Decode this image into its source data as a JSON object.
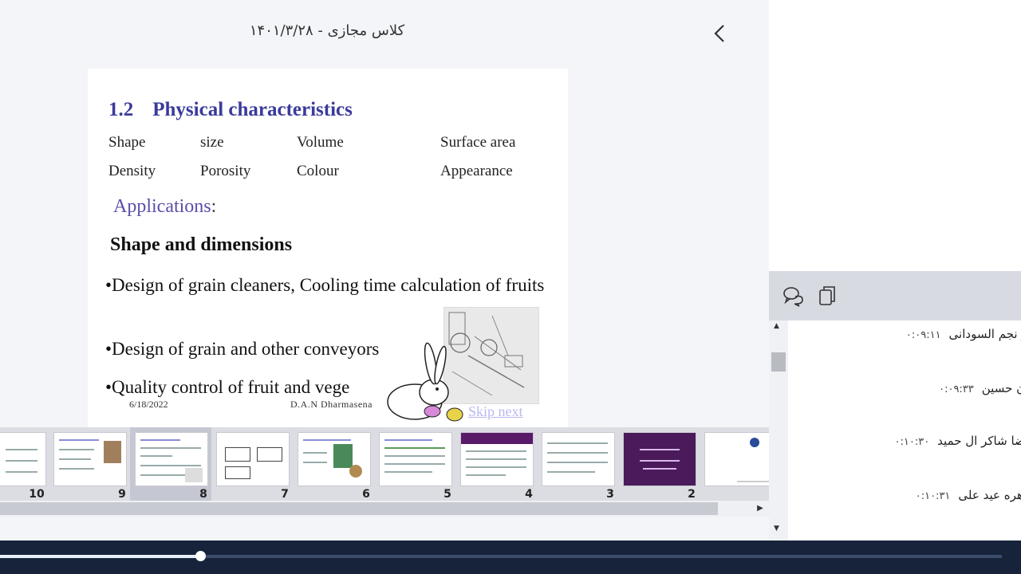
{
  "header": {
    "title": "کلاس مجازی - ۱۴۰۱/۳/۲۸",
    "back_icon": "chevron-left-icon"
  },
  "slide": {
    "heading_number": "1.2",
    "heading_text": "Physical characteristics",
    "characteristics": [
      "Shape",
      "size",
      "Volume",
      "Surface area",
      "Density",
      "Porosity",
      "Colour",
      "Appearance"
    ],
    "applications_label": "Applications",
    "applications_colon": ":",
    "subheading": "Shape and dimensions",
    "bullets": [
      "•Design of grain cleaners, Cooling time calculation of fruits",
      "•Design of grain and other conveyors",
      "•Quality control of fruit and vege"
    ],
    "footer_date": "6/18/2022",
    "footer_author": "D.A.N Dharmasena",
    "skip_label": "Skip next"
  },
  "thumbnails": {
    "numbers": [
      "10",
      "9",
      "8",
      "7",
      "6",
      "5",
      "4",
      "3",
      "2"
    ],
    "active_number": "8"
  },
  "panel": {
    "tools": [
      "chat-icon",
      "copy-icon"
    ],
    "messages": [
      {
        "name": "عزیز نجم السودانی",
        "time": "۰:۰۹:۱۱"
      },
      {
        "name": "دان حسین",
        "time": "۰:۰۹:۳۳"
      },
      {
        "name": "رضا شاکر ال حمید",
        "time": "۰:۱۰:۳۰"
      },
      {
        "name": "زهره عید علی",
        "time": "۰:۱۰:۳۱"
      }
    ]
  },
  "player": {
    "progress": 0.2
  },
  "colors": {
    "heading": "#3a3a9c",
    "applications": "#5a4fa8",
    "player_bg": "#16233a",
    "skip_link": "#b8b8f0"
  }
}
